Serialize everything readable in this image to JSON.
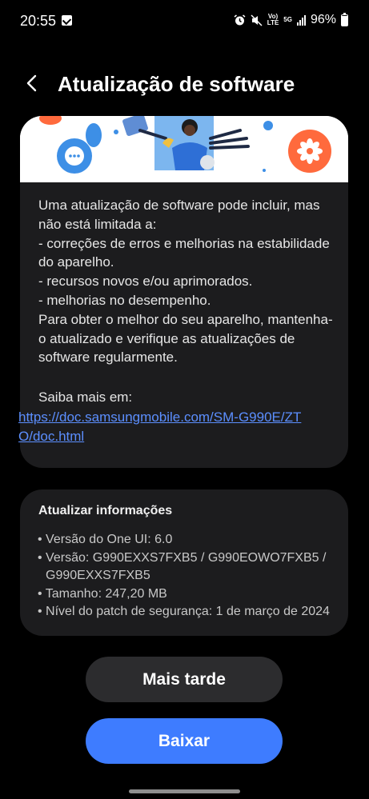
{
  "status_bar": {
    "time": "20:55",
    "battery": "96%",
    "network": "5G",
    "network_sub": "LTE",
    "volte": "Vo)"
  },
  "header": {
    "title": "Atualização de software",
    "back_icon": "chevron-left-icon"
  },
  "description": {
    "body": "Uma atualização de software pode incluir, mas não está limitada a:\n - correções de erros e melhorias na estabilidade do aparelho.\n - recursos novos e/ou aprimorados.\n - melhorias no desempenho.\nPara obter o melhor do seu aparelho, mantenha-o atualizado e verifique as atualizações de software regularmente.",
    "learn_more": "Saiba mais em:",
    "link": "https://doc.samsungmobile.com/SM-G990E/ZTO/doc.html"
  },
  "update_info": {
    "title": "Atualizar informações",
    "items": [
      "• Versão do One UI: 6.0",
      "• Versão: G990EXXS7FXB5 / G990EOWO7FXB5 / G990EXXS7FXB5",
      "• Tamanho: 247,20 MB",
      "• Nível do patch de segurança: 1 de março de 2024"
    ]
  },
  "actions": {
    "later": "Mais tarde",
    "download": "Baixar"
  },
  "colors": {
    "background": "#000000",
    "card": "#1c1c1e",
    "accent": "#3e7cff",
    "link": "#5c8fff"
  }
}
